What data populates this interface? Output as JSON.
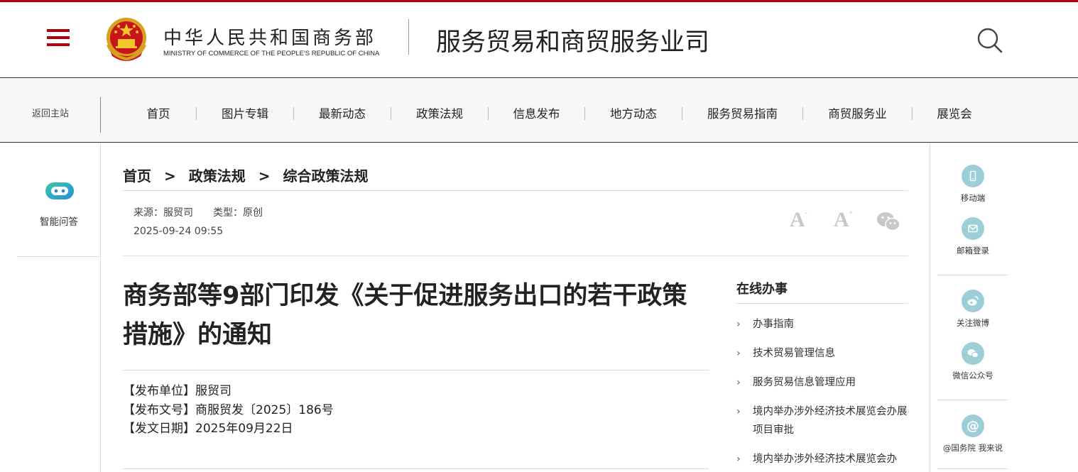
{
  "header": {
    "ministry_cn": "中华人民共和国商务部",
    "ministry_en": "MINISTRY OF COMMERCE OF THE PEOPLE'S REPUBLIC OF CHINA",
    "dept_title": "服务贸易和商贸服务业司",
    "icons": {
      "menu": "hamburger-menu-icon",
      "emblem": "national-emblem",
      "search": "search-icon"
    },
    "brand_color": "#b4000c"
  },
  "nav": {
    "back_home": "返回主站",
    "items": [
      "首页",
      "图片专辑",
      "最新动态",
      "政策法规",
      "信息发布",
      "地方动态",
      "服务贸易指南",
      "商贸服务业",
      "展览会"
    ]
  },
  "left_sidebar": {
    "ai_label": "智能问答",
    "ai_icon": "robot-chat-icon"
  },
  "right_sidebar": {
    "items": [
      {
        "label": "移动端",
        "icon": "mobile-icon"
      },
      {
        "label": "邮箱登录",
        "icon": "mail-icon"
      },
      {
        "label": "关注微博",
        "icon": "weibo-icon"
      },
      {
        "label": "微信公众号",
        "icon": "wechat-icon"
      },
      {
        "label": "@国务院 我来说",
        "icon": "at-icon"
      }
    ],
    "accent_color": "#9ccfd6"
  },
  "breadcrumb": {
    "items": [
      "首页",
      "政策法规",
      "综合政策法规"
    ],
    "separator": ">"
  },
  "meta": {
    "source": "来源：服贸司",
    "type": "类型：原创",
    "datetime": "2025-09-24 09:55",
    "tools": {
      "font_decrease": "A",
      "font_increase": "A",
      "share_icon": "wechat-share-icon"
    }
  },
  "article": {
    "title": "商务部等9部门印发《关于促进服务出口的若干政策措施》的通知",
    "publisher": "【发布单位】服贸司",
    "doc_number": "【发布文号】商服贸发〔2025〕186号",
    "issue_date": "【发文日期】2025年09月22日"
  },
  "services": {
    "title": "在线办事",
    "items": [
      "办事指南",
      "技术贸易管理信息",
      "服务贸易信息管理应用",
      "境内举办涉外经济技术展览会办展项目审批",
      "境内举办涉外经济技术展览会办"
    ]
  }
}
